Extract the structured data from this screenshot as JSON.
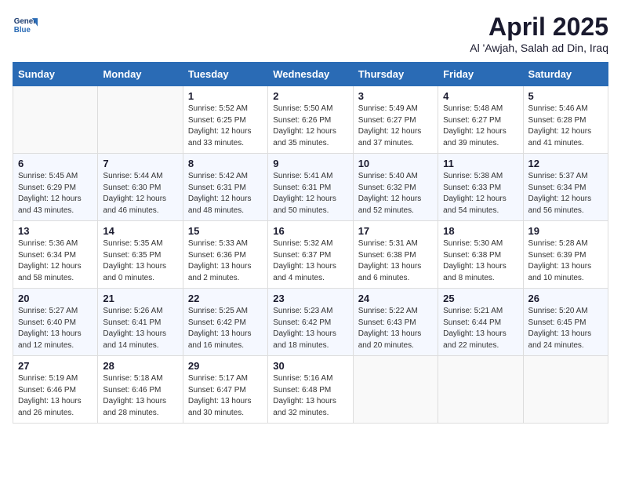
{
  "logo": {
    "line1": "General",
    "line2": "Blue"
  },
  "title": "April 2025",
  "location": "Al 'Awjah, Salah ad Din, Iraq",
  "days_header": [
    "Sunday",
    "Monday",
    "Tuesday",
    "Wednesday",
    "Thursday",
    "Friday",
    "Saturday"
  ],
  "weeks": [
    [
      {
        "day": "",
        "info": ""
      },
      {
        "day": "",
        "info": ""
      },
      {
        "day": "1",
        "info": "Sunrise: 5:52 AM\nSunset: 6:25 PM\nDaylight: 12 hours\nand 33 minutes."
      },
      {
        "day": "2",
        "info": "Sunrise: 5:50 AM\nSunset: 6:26 PM\nDaylight: 12 hours\nand 35 minutes."
      },
      {
        "day": "3",
        "info": "Sunrise: 5:49 AM\nSunset: 6:27 PM\nDaylight: 12 hours\nand 37 minutes."
      },
      {
        "day": "4",
        "info": "Sunrise: 5:48 AM\nSunset: 6:27 PM\nDaylight: 12 hours\nand 39 minutes."
      },
      {
        "day": "5",
        "info": "Sunrise: 5:46 AM\nSunset: 6:28 PM\nDaylight: 12 hours\nand 41 minutes."
      }
    ],
    [
      {
        "day": "6",
        "info": "Sunrise: 5:45 AM\nSunset: 6:29 PM\nDaylight: 12 hours\nand 43 minutes."
      },
      {
        "day": "7",
        "info": "Sunrise: 5:44 AM\nSunset: 6:30 PM\nDaylight: 12 hours\nand 46 minutes."
      },
      {
        "day": "8",
        "info": "Sunrise: 5:42 AM\nSunset: 6:31 PM\nDaylight: 12 hours\nand 48 minutes."
      },
      {
        "day": "9",
        "info": "Sunrise: 5:41 AM\nSunset: 6:31 PM\nDaylight: 12 hours\nand 50 minutes."
      },
      {
        "day": "10",
        "info": "Sunrise: 5:40 AM\nSunset: 6:32 PM\nDaylight: 12 hours\nand 52 minutes."
      },
      {
        "day": "11",
        "info": "Sunrise: 5:38 AM\nSunset: 6:33 PM\nDaylight: 12 hours\nand 54 minutes."
      },
      {
        "day": "12",
        "info": "Sunrise: 5:37 AM\nSunset: 6:34 PM\nDaylight: 12 hours\nand 56 minutes."
      }
    ],
    [
      {
        "day": "13",
        "info": "Sunrise: 5:36 AM\nSunset: 6:34 PM\nDaylight: 12 hours\nand 58 minutes."
      },
      {
        "day": "14",
        "info": "Sunrise: 5:35 AM\nSunset: 6:35 PM\nDaylight: 13 hours\nand 0 minutes."
      },
      {
        "day": "15",
        "info": "Sunrise: 5:33 AM\nSunset: 6:36 PM\nDaylight: 13 hours\nand 2 minutes."
      },
      {
        "day": "16",
        "info": "Sunrise: 5:32 AM\nSunset: 6:37 PM\nDaylight: 13 hours\nand 4 minutes."
      },
      {
        "day": "17",
        "info": "Sunrise: 5:31 AM\nSunset: 6:38 PM\nDaylight: 13 hours\nand 6 minutes."
      },
      {
        "day": "18",
        "info": "Sunrise: 5:30 AM\nSunset: 6:38 PM\nDaylight: 13 hours\nand 8 minutes."
      },
      {
        "day": "19",
        "info": "Sunrise: 5:28 AM\nSunset: 6:39 PM\nDaylight: 13 hours\nand 10 minutes."
      }
    ],
    [
      {
        "day": "20",
        "info": "Sunrise: 5:27 AM\nSunset: 6:40 PM\nDaylight: 13 hours\nand 12 minutes."
      },
      {
        "day": "21",
        "info": "Sunrise: 5:26 AM\nSunset: 6:41 PM\nDaylight: 13 hours\nand 14 minutes."
      },
      {
        "day": "22",
        "info": "Sunrise: 5:25 AM\nSunset: 6:42 PM\nDaylight: 13 hours\nand 16 minutes."
      },
      {
        "day": "23",
        "info": "Sunrise: 5:23 AM\nSunset: 6:42 PM\nDaylight: 13 hours\nand 18 minutes."
      },
      {
        "day": "24",
        "info": "Sunrise: 5:22 AM\nSunset: 6:43 PM\nDaylight: 13 hours\nand 20 minutes."
      },
      {
        "day": "25",
        "info": "Sunrise: 5:21 AM\nSunset: 6:44 PM\nDaylight: 13 hours\nand 22 minutes."
      },
      {
        "day": "26",
        "info": "Sunrise: 5:20 AM\nSunset: 6:45 PM\nDaylight: 13 hours\nand 24 minutes."
      }
    ],
    [
      {
        "day": "27",
        "info": "Sunrise: 5:19 AM\nSunset: 6:46 PM\nDaylight: 13 hours\nand 26 minutes."
      },
      {
        "day": "28",
        "info": "Sunrise: 5:18 AM\nSunset: 6:46 PM\nDaylight: 13 hours\nand 28 minutes."
      },
      {
        "day": "29",
        "info": "Sunrise: 5:17 AM\nSunset: 6:47 PM\nDaylight: 13 hours\nand 30 minutes."
      },
      {
        "day": "30",
        "info": "Sunrise: 5:16 AM\nSunset: 6:48 PM\nDaylight: 13 hours\nand 32 minutes."
      },
      {
        "day": "",
        "info": ""
      },
      {
        "day": "",
        "info": ""
      },
      {
        "day": "",
        "info": ""
      }
    ]
  ]
}
